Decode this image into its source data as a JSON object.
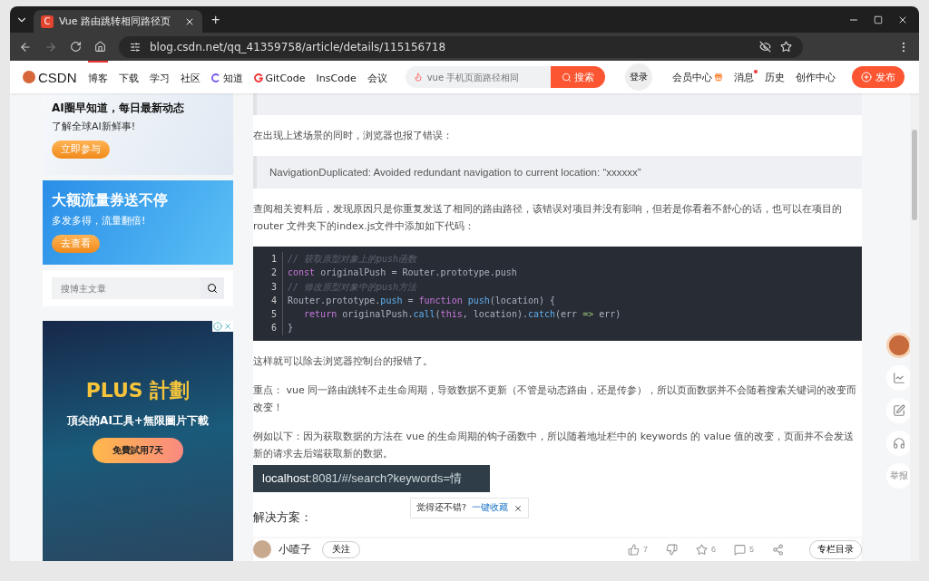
{
  "browser": {
    "favicon": "C",
    "tab_title": "Vue 路由跳转相同路径页",
    "new_tab": "+",
    "url": "blog.csdn.net/qq_41359758/article/details/115156718"
  },
  "header": {
    "logo": "CSDN",
    "nav": [
      {
        "label": "博客",
        "selected": true
      },
      {
        "label": "下载",
        "selected": false
      },
      {
        "label": "学习",
        "selected": false
      },
      {
        "label": "社区",
        "selected": false
      },
      {
        "label": "知道",
        "selected": false,
        "kind": "zhidao"
      },
      {
        "label": "GitCode",
        "selected": false,
        "kind": "gitcode"
      },
      {
        "label": "InsCode",
        "selected": false
      },
      {
        "label": "会议",
        "selected": false
      }
    ],
    "search": {
      "placeholder": "vue 手机页面路径相同",
      "button": "搜索"
    },
    "login": "登录",
    "links": [
      {
        "label": "会员中心",
        "kind": "gift"
      },
      {
        "label": "消息",
        "kind": "dot"
      },
      {
        "label": "历史"
      },
      {
        "label": "创作中心"
      }
    ],
    "publish": "发布"
  },
  "sidebar": {
    "ads": [
      {
        "title": "AI圈早知道，每日最新动态",
        "subtitle": "了解全球AI新鲜事!",
        "button": "立即参与",
        "kind": "light"
      },
      {
        "title": "大额流量券送不停",
        "subtitle": "多发多得，流量翻倍!",
        "button": "去查看",
        "kind": "blue"
      }
    ],
    "search": {
      "placeholder": "搜博主文章"
    },
    "promo": {
      "title": "PLUS 計劃",
      "subtitle": "頂尖的AI工具+無限圖片下載",
      "button": "免費試用7天"
    }
  },
  "article": {
    "blocks": [
      {
        "kind": "quote"
      },
      {
        "kind": "para",
        "text": "在出现上述场景的同时，浏览器也报了错误："
      },
      {
        "kind": "quote",
        "text": "NavigationDuplicated: Avoided redundant navigation to current location: “xxxxxx”"
      },
      {
        "kind": "para",
        "text": "查阅相关资料后，发现原因只是你重复发送了相同的路由路径，该错误对项目并没有影响，但若是你看着不舒心的话，也可以在项目的router 文件夹下的index.js文件中添加如下代码："
      },
      {
        "kind": "code",
        "lines": [
          {
            "no": "1",
            "tokens": [
              {
                "kind": "comment",
                "text": "// 获取原型对象上的push函数"
              }
            ]
          },
          {
            "no": "2",
            "tokens": [
              {
                "kind": "keyword",
                "text": "const"
              },
              {
                "kind": "plain",
                "text": " originalPush = Router.prototype.push"
              }
            ]
          },
          {
            "no": "3",
            "tokens": [
              {
                "kind": "comment",
                "text": "// 修改原型对象中的push方法"
              }
            ]
          },
          {
            "no": "4",
            "tokens": [
              {
                "kind": "plain",
                "text": "Router.prototype."
              },
              {
                "kind": "function",
                "text": "push"
              },
              {
                "kind": "plain",
                "text": " = "
              },
              {
                "kind": "keyword",
                "text": "function"
              },
              {
                "kind": "function",
                "text": " push"
              },
              {
                "kind": "plain",
                "text": "(location) {"
              }
            ]
          },
          {
            "no": "5",
            "tokens": [
              {
                "kind": "keyword",
                "text": "   return"
              },
              {
                "kind": "plain",
                "text": " originalPush."
              },
              {
                "kind": "function",
                "text": "call"
              },
              {
                "kind": "plain",
                "text": "("
              },
              {
                "kind": "keyword",
                "text": "this"
              },
              {
                "kind": "plain",
                "text": ", location)."
              },
              {
                "kind": "function",
                "text": "catch"
              },
              {
                "kind": "plain",
                "text": "(err "
              },
              {
                "kind": "operator",
                "text": "=>"
              },
              {
                "kind": "plain",
                "text": " err)"
              }
            ]
          },
          {
            "no": "6",
            "tokens": [
              {
                "kind": "plain",
                "text": "}"
              }
            ]
          }
        ]
      },
      {
        "kind": "para",
        "text": "这样就可以除去浏览器控制台的报错了。"
      },
      {
        "kind": "para",
        "text": "重点： vue 同一路由跳转不走生命周期，导致数据不更新（不管是动态路由，还是传参），所以页面数据并不会随着搜索关键词的改变而改变！"
      },
      {
        "kind": "para",
        "text": "例如以下：因为获取数据的方法在 vue 的生命周期的钩子函数中，所以随着地址栏中的 keywords 的 value 值的改变，页面并不会发送新的请求去后端获取新的数据。"
      },
      {
        "kind": "urlbar",
        "host": "localhost",
        "rest": ":8081/#/search?keywords=情"
      },
      {
        "kind": "heading",
        "text": "解决方案："
      }
    ]
  },
  "tooltip": {
    "text": "觉得还不错?",
    "link": "一键收藏"
  },
  "footer": {
    "author": "小喳子",
    "follow": "关注",
    "likes": "7",
    "stars": "6",
    "comments": "5",
    "toc": "专栏目录"
  },
  "float_tools": {
    "report": "举报"
  }
}
